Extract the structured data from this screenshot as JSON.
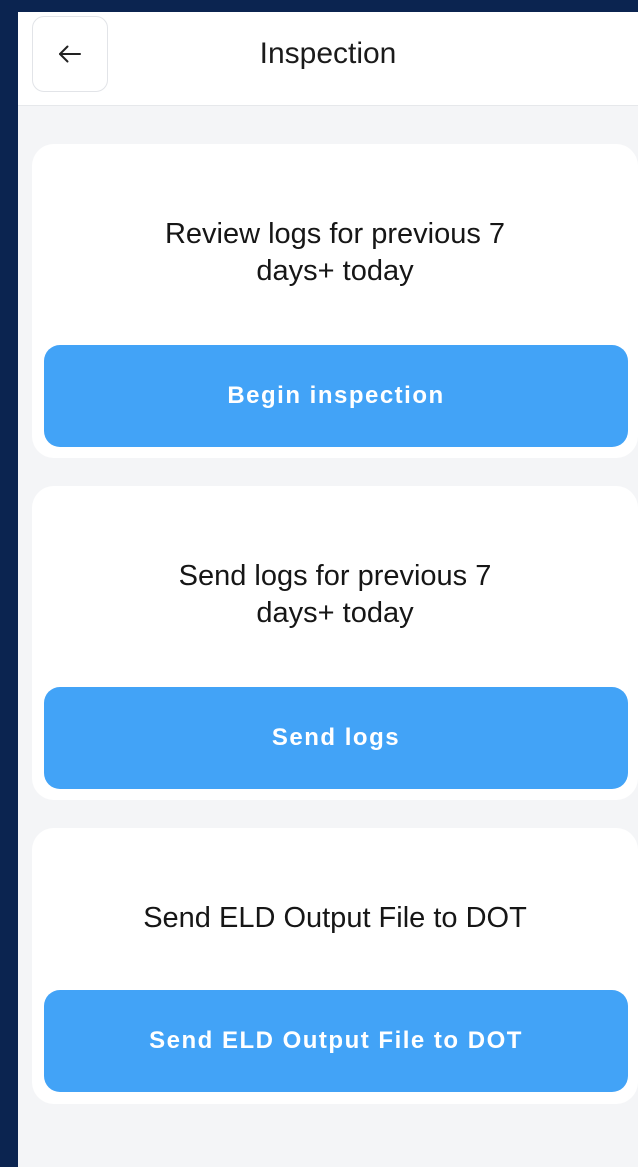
{
  "header": {
    "title": "Inspection",
    "back_icon": "arrow-left-icon"
  },
  "cards": [
    {
      "description": "Review logs for previous 7\ndays+ today",
      "button_label": "Begin inspection"
    },
    {
      "description": "Send logs for previous 7\ndays+ today",
      "button_label": "Send logs"
    },
    {
      "description": "Send ELD Output File to DOT",
      "button_label": "Send ELD Output File to DOT"
    }
  ],
  "colors": {
    "outer_background": "#0b2450",
    "screen_background": "#f4f5f7",
    "card_background": "#ffffff",
    "button_background": "#42a3f7",
    "button_text": "#ffffff"
  }
}
